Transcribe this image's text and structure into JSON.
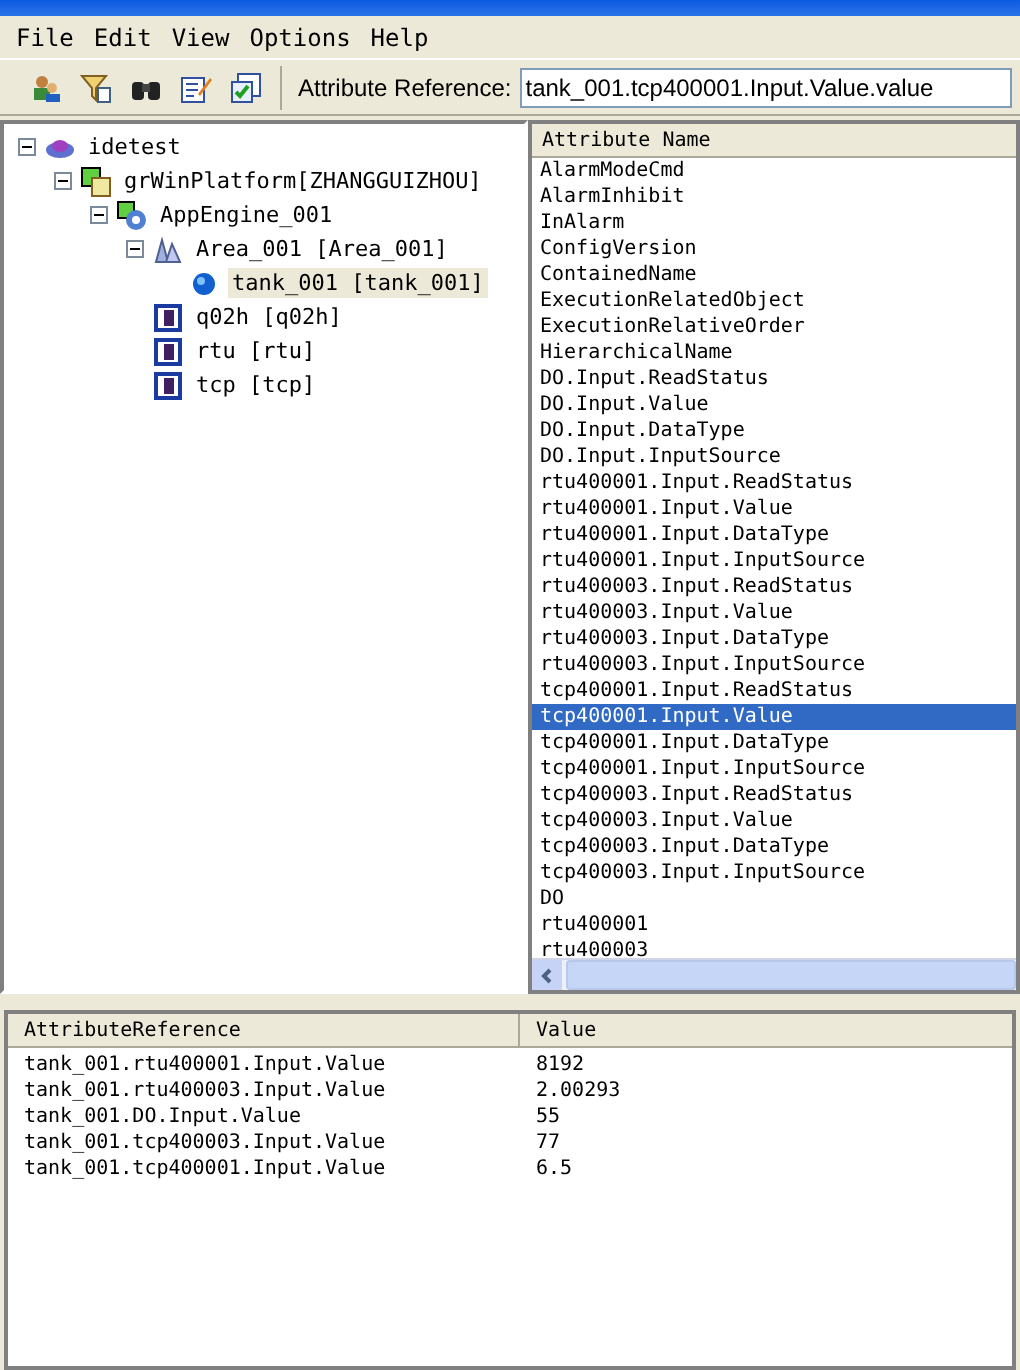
{
  "menu": [
    {
      "label": "File"
    },
    {
      "label": "Edit"
    },
    {
      "label": "View"
    },
    {
      "label": "Options"
    },
    {
      "label": "Help"
    }
  ],
  "toolbar": {
    "buttons": [
      {
        "kind": "people"
      },
      {
        "kind": "filter"
      },
      {
        "kind": "binoculars"
      },
      {
        "kind": "edit"
      },
      {
        "kind": "checklist"
      }
    ],
    "reference_label": "Attribute Reference:",
    "reference_value": "tank_001.tcp400001.Input.Value.value"
  },
  "tree": [
    {
      "label": "idetest",
      "kind": "galaxy",
      "expanded": true,
      "selected": false,
      "children": [
        {
          "label": "grWinPlatform[ZHANGGUIZHOU]",
          "kind": "platform",
          "expanded": true,
          "selected": false,
          "children": [
            {
              "label": "AppEngine_001",
              "kind": "engine",
              "expanded": true,
              "selected": false,
              "children": [
                {
                  "label": "Area_001 [Area_001]",
                  "kind": "area",
                  "expanded": true,
                  "selected": false,
                  "children": [
                    {
                      "label": "tank_001 [tank_001]",
                      "kind": "object",
                      "selected": true
                    }
                  ]
                },
                {
                  "label": "q02h [q02h]",
                  "kind": "device",
                  "selected": false
                },
                {
                  "label": "rtu [rtu]",
                  "kind": "device",
                  "selected": false
                },
                {
                  "label": "tcp [tcp]",
                  "kind": "device",
                  "selected": false
                }
              ]
            }
          ]
        }
      ]
    }
  ],
  "attributes": {
    "header": "Attribute Name",
    "rows": [
      {
        "name": "AlarmModeCmd",
        "selected": false
      },
      {
        "name": "AlarmInhibit",
        "selected": false
      },
      {
        "name": "InAlarm",
        "selected": false
      },
      {
        "name": "ConfigVersion",
        "selected": false
      },
      {
        "name": "ContainedName",
        "selected": false
      },
      {
        "name": "ExecutionRelatedObject",
        "selected": false
      },
      {
        "name": "ExecutionRelativeOrder",
        "selected": false
      },
      {
        "name": "HierarchicalName",
        "selected": false
      },
      {
        "name": "DO.Input.ReadStatus",
        "selected": false
      },
      {
        "name": "DO.Input.Value",
        "selected": false
      },
      {
        "name": "DO.Input.DataType",
        "selected": false
      },
      {
        "name": "DO.Input.InputSource",
        "selected": false
      },
      {
        "name": "rtu400001.Input.ReadStatus",
        "selected": false
      },
      {
        "name": "rtu400001.Input.Value",
        "selected": false
      },
      {
        "name": "rtu400001.Input.DataType",
        "selected": false
      },
      {
        "name": "rtu400001.Input.InputSource",
        "selected": false
      },
      {
        "name": "rtu400003.Input.ReadStatus",
        "selected": false
      },
      {
        "name": "rtu400003.Input.Value",
        "selected": false
      },
      {
        "name": "rtu400003.Input.DataType",
        "selected": false
      },
      {
        "name": "rtu400003.Input.InputSource",
        "selected": false
      },
      {
        "name": "tcp400001.Input.ReadStatus",
        "selected": false
      },
      {
        "name": "tcp400001.Input.Value",
        "selected": true
      },
      {
        "name": "tcp400001.Input.DataType",
        "selected": false
      },
      {
        "name": "tcp400001.Input.InputSource",
        "selected": false
      },
      {
        "name": "tcp400003.Input.ReadStatus",
        "selected": false
      },
      {
        "name": "tcp400003.Input.Value",
        "selected": false
      },
      {
        "name": "tcp400003.Input.DataType",
        "selected": false
      },
      {
        "name": "tcp400003.Input.InputSource",
        "selected": false
      },
      {
        "name": "DO",
        "selected": false
      },
      {
        "name": "rtu400001",
        "selected": false
      },
      {
        "name": "rtu400003",
        "selected": false
      }
    ]
  },
  "watch": {
    "columns": [
      "AttributeReference",
      "Value"
    ],
    "rows": [
      [
        "tank_001.rtu400001.Input.Value",
        "8192"
      ],
      [
        "tank_001.rtu400003.Input.Value",
        "2.00293"
      ],
      [
        "tank_001.DO.Input.Value",
        "55"
      ],
      [
        "tank_001.tcp400003.Input.Value",
        "77"
      ],
      [
        "tank_001.tcp400001.Input.Value",
        "6.5"
      ]
    ]
  }
}
